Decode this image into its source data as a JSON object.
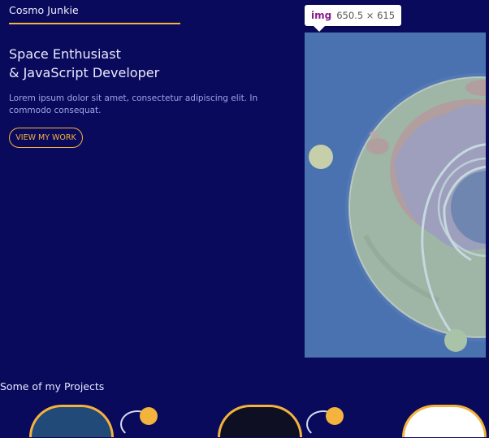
{
  "header": {
    "brand": "Cosmo Junkie"
  },
  "hero": {
    "title_line1": "Space Enthusiast",
    "title_line2": "& JavaScript Developer",
    "description": "Lorem ipsum dolor sit amet, consectetur adipiscing elit. In commodo consequat.",
    "cta_label": "VIEW MY WORK"
  },
  "inspector_tooltip": {
    "tag": "img",
    "dimensions": "650.5 × 615"
  },
  "projects": {
    "title": "Some of my Projects"
  },
  "colors": {
    "background": "#0a0a5c",
    "accent": "#f3b33d",
    "highlight_overlay": "#4a72b0"
  }
}
